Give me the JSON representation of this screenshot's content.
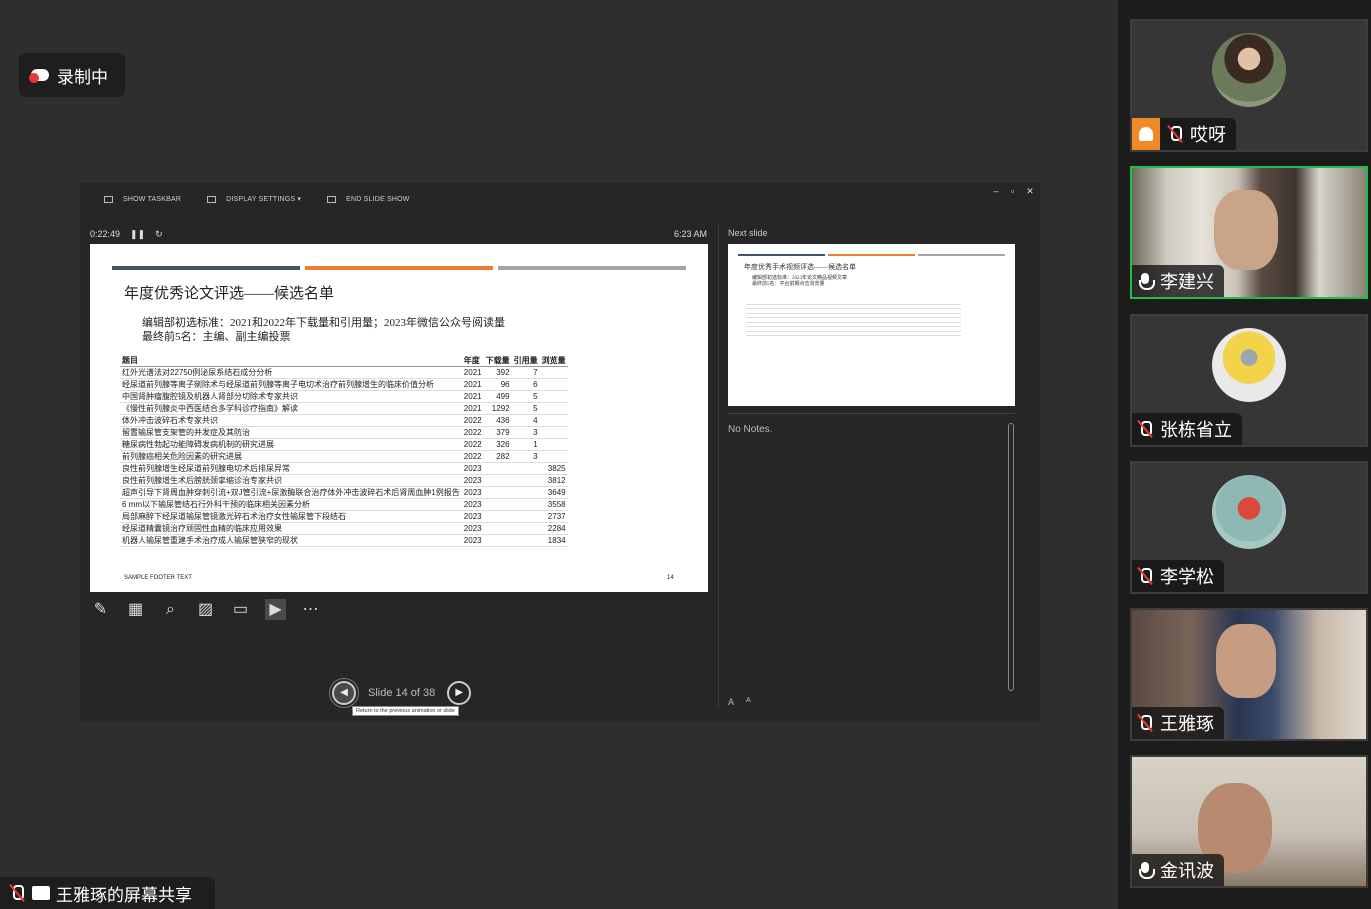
{
  "recording": {
    "label": "录制中"
  },
  "presenter": {
    "toolbar": {
      "show_taskbar": "SHOW TASKBAR",
      "display_settings": "DISPLAY SETTINGS ▾",
      "end_slide_show": "END SLIDE SHOW"
    },
    "timer": "0:22:49",
    "clock": "6:23 AM",
    "next_slide_label": "Next slide",
    "notes": "No Notes.",
    "slide_counter": "Slide 14 of 38",
    "prev_tooltip": "Return to the previous animation or slide",
    "font_buttons": [
      "A",
      "A"
    ]
  },
  "slide": {
    "title": "年度优秀论文评选——候选名单",
    "criteria_line1": "编辑部初选标准：2021和2022年下载量和引用量；2023年微信公众号阅读量",
    "criteria_line2": "最终前5名：主编、副主编投票",
    "headers": [
      "题目",
      "年度",
      "下载量",
      "引用量",
      "浏览量"
    ],
    "rows": [
      [
        "红外光谱法对22750例泌尿系结石成分分析",
        "2021",
        "392",
        "7",
        ""
      ],
      [
        "经尿道前列腺等离子剜除术与经尿道前列腺等离子电切术治疗前列腺增生的临床价值分析",
        "2021",
        "96",
        "6",
        ""
      ],
      [
        "中国肾肿瘤腹腔镜及机器人肾部分切除术专家共识",
        "2021",
        "499",
        "5",
        ""
      ],
      [
        "《慢性前列腺炎中西医结合多学科诊疗指南》解读",
        "2021",
        "1292",
        "5",
        ""
      ],
      [
        "体外冲击波碎石术专家共识",
        "2022",
        "436",
        "4",
        ""
      ],
      [
        "留置输尿管支架管的并发症及其防治",
        "2022",
        "379",
        "3",
        ""
      ],
      [
        "糖尿病性勃起功能障碍发病机制的研究进展",
        "2022",
        "326",
        "1",
        ""
      ],
      [
        "前列腺癌相关危险因素的研究进展",
        "2022",
        "282",
        "3",
        ""
      ],
      [
        "良性前列腺增生经尿道前列腺电切术后排尿异常",
        "2023",
        "",
        "",
        "3825"
      ],
      [
        "良性前列腺增生术后膀胱颈挛缩诊治专家共识",
        "2023",
        "",
        "",
        "3812"
      ],
      [
        "超声引导下肾周血肿穿刺引流+双J管引流+尿激酶联合治疗体外冲击波碎石术后肾周血肿1例报告",
        "2023",
        "",
        "",
        "3649"
      ],
      [
        "6 mm以下输尿管结石行外科干预的临床相关因素分析",
        "2023",
        "",
        "",
        "3558"
      ],
      [
        "局部麻醉下经尿道输尿管镜激光碎石术治疗女性输尿管下段结石",
        "2023",
        "",
        "",
        "2737"
      ],
      [
        "经尿道精囊镜治疗顽固性血精的临床应用效果",
        "2023",
        "",
        "",
        "2284"
      ],
      [
        "机器人输尿管重建手术治疗成人输尿管狭窄的现状",
        "2023",
        "",
        "",
        "1834"
      ]
    ],
    "footer": "SAMPLE FOOTER TEXT",
    "page": "14"
  },
  "next_slide": {
    "title": "年度优秀手术视频评选——候选名单",
    "criteria_line1": "编辑部初选标准：2023年论文精品视频文章",
    "criteria_line2": "最终前5名：平台前期点击浏览量"
  },
  "share": {
    "label": "王雅琢的屏幕共享"
  },
  "participants": [
    {
      "name": "哎呀",
      "mic": "off",
      "host": true
    },
    {
      "name": "李建兴",
      "mic": "on",
      "host": false,
      "speaking": true
    },
    {
      "name": "张栋省立",
      "mic": "off",
      "host": false
    },
    {
      "name": "李学松",
      "mic": "off",
      "host": false
    },
    {
      "name": "王雅琢",
      "mic": "off",
      "host": false
    },
    {
      "name": "金讯波",
      "mic": "on",
      "host": false
    }
  ],
  "colors": {
    "bar1": "#44546a",
    "bar2": "#ed7d31",
    "bar3": "#a5a5a5",
    "speaking": "#1fbe4a",
    "host": "#f08a24",
    "muted": "#e53935"
  }
}
